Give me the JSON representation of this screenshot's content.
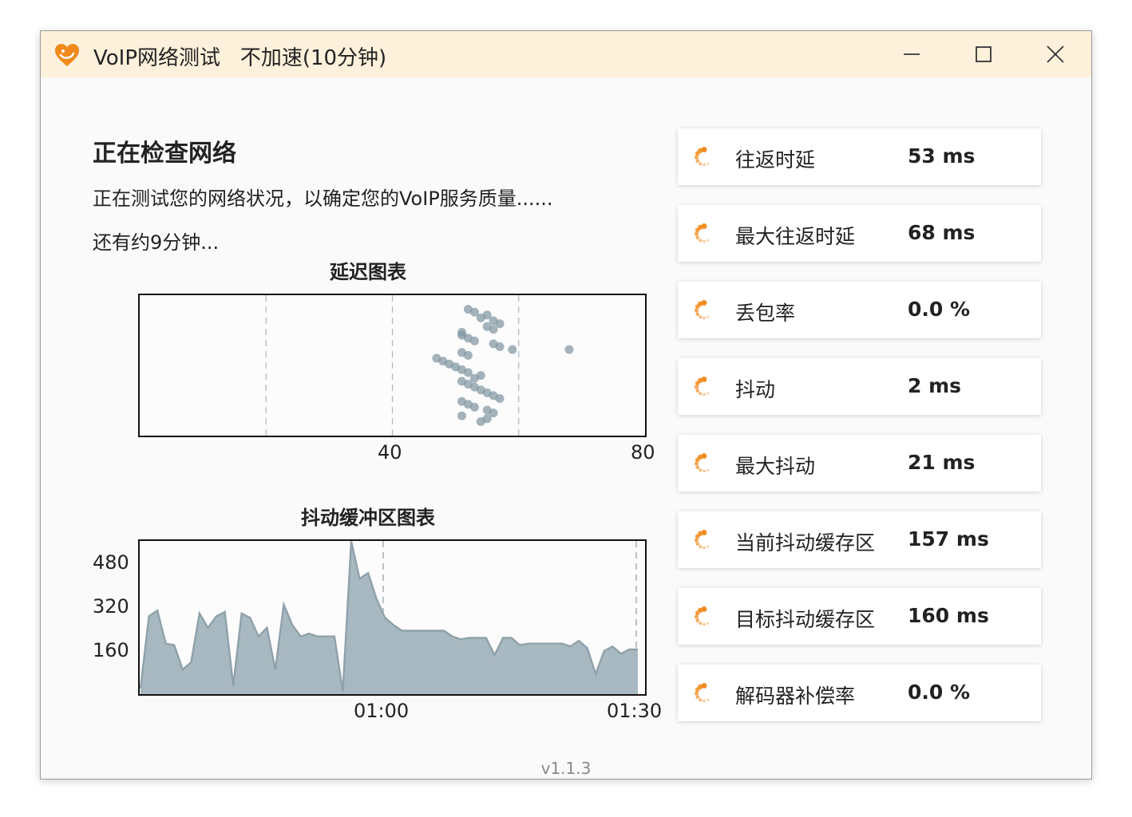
{
  "window": {
    "title": "VoIP网络测试",
    "mode": "不加速(10分钟)",
    "accent": "#f08a1c",
    "titlebar_bg": "#fdf1dc"
  },
  "main": {
    "heading": "正在检查网络",
    "description": "正在测试您的网络状况，以确定您的VoIP服务质量......",
    "remaining": "还有约9分钟..."
  },
  "latency_chart": {
    "title": "延迟图表",
    "x_ticks": [
      "40",
      "80"
    ]
  },
  "jitter_chart": {
    "title": "抖动缓冲区图表",
    "x_ticks": [
      "01:00",
      "01:30"
    ],
    "y_ticks": [
      "480",
      "320",
      "160"
    ]
  },
  "metrics": [
    {
      "label": "往返时延",
      "value": "53 ms"
    },
    {
      "label": "最大往返时延",
      "value": "68 ms"
    },
    {
      "label": "丢包率",
      "value": "0.0 %"
    },
    {
      "label": "抖动",
      "value": "2 ms"
    },
    {
      "label": "最大抖动",
      "value": "21 ms"
    },
    {
      "label": "当前抖动缓存区",
      "value": "157 ms"
    },
    {
      "label": "目标抖动缓存区",
      "value": "160 ms"
    },
    {
      "label": "解码器补偿率",
      "value": "0.0 %"
    }
  ],
  "version": "v1.1.3",
  "chart_data": [
    {
      "type": "scatter",
      "title": "延迟图表",
      "xlim": [
        0,
        80
      ],
      "gridlines_x": [
        20,
        40,
        60
      ],
      "x": [
        52,
        53,
        55,
        54,
        56,
        57,
        55,
        56,
        51,
        51,
        52,
        53,
        56,
        57,
        59,
        51,
        52,
        47,
        48,
        49,
        50,
        51,
        52,
        54,
        53,
        51,
        52,
        53,
        54,
        55,
        56,
        57,
        51,
        52,
        53,
        55,
        56,
        51,
        55,
        54,
        68
      ],
      "y": [
        1,
        2,
        3,
        4,
        5,
        6,
        7,
        8,
        9,
        10,
        11,
        12,
        13,
        14,
        15,
        16,
        17,
        18,
        19,
        20,
        21,
        22,
        23,
        24,
        25,
        26,
        27,
        28,
        29,
        30,
        31,
        32,
        33,
        34,
        35,
        36,
        37,
        38,
        39,
        40,
        15
      ],
      "point_color": "#7d93a0"
    },
    {
      "type": "area",
      "title": "抖动缓冲区图表",
      "ylim": [
        0,
        520
      ],
      "x_ticks": [
        "01:00",
        "01:30"
      ],
      "y_ticks": [
        160,
        320,
        480
      ],
      "values": [
        20,
        270,
        290,
        175,
        170,
        85,
        110,
        280,
        230,
        270,
        285,
        30,
        280,
        265,
        200,
        230,
        85,
        310,
        240,
        200,
        210,
        200,
        200,
        200,
        10,
        530,
        400,
        420,
        330,
        265,
        240,
        220,
        220,
        220,
        220,
        220,
        220,
        200,
        190,
        195,
        195,
        195,
        135,
        195,
        195,
        170,
        175,
        175,
        175,
        175,
        175,
        165,
        185,
        160,
        70,
        150,
        165,
        140,
        155,
        155
      ],
      "fill": "#a8b8c0",
      "stroke": "#8fa1ab"
    }
  ]
}
